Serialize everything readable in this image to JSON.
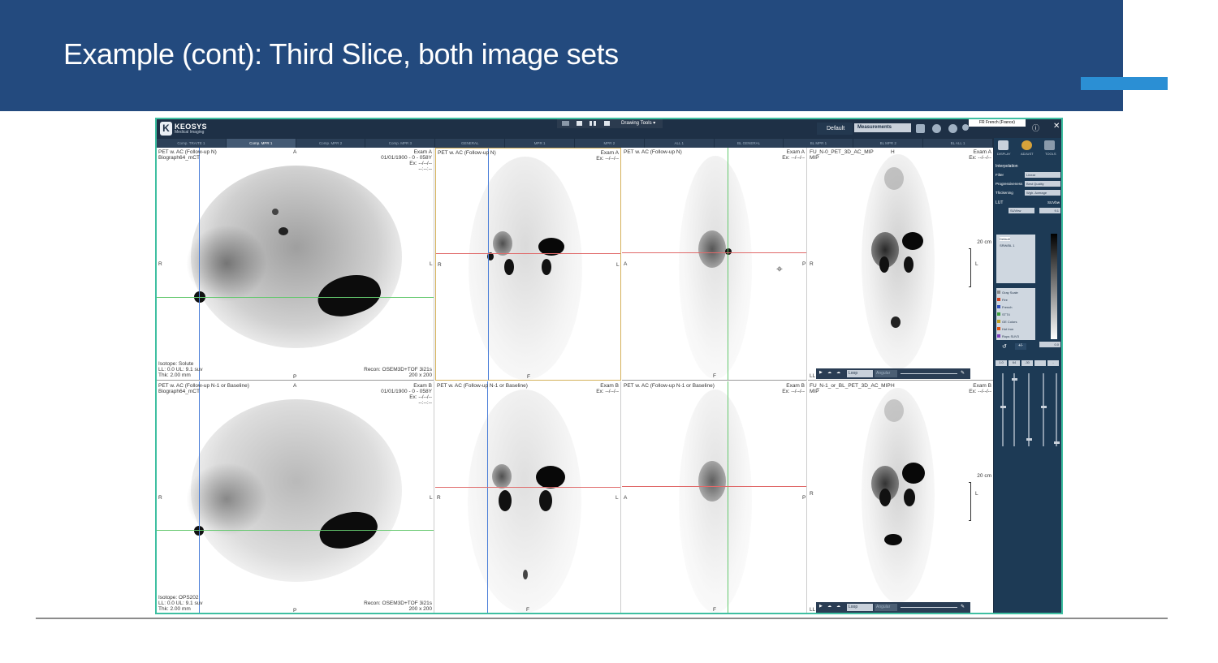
{
  "slide": {
    "title": "Example (cont): Third Slice, both image sets"
  },
  "app": {
    "logo_mark": "K",
    "logo_name": "KEOSYS",
    "logo_sub": "Medical Imaging",
    "drawing_tools": "Drawing Tools ▾",
    "preset": "Default",
    "measurements": "Measurements",
    "locale": "FR French (France)",
    "info_icon": "ⓘ",
    "close_icon": "✕"
  },
  "tabs": [
    "Comp. TRAITE 1",
    "Comp. MPR 1",
    "Comp. MPR 2",
    "Comp. MPR 3",
    "GENERAL",
    "MPR 1",
    "MPR 2",
    "ALL 1",
    "BL GENERAL",
    "BL MPR 1",
    "BL MPR 2",
    "BL ALL 1"
  ],
  "active_tab": 1,
  "top": {
    "axial": {
      "name": "PET w. AC (Follow-up N)",
      "scanner": "Biograph64_mCT",
      "orient_top": "A",
      "exam": "Exam A",
      "date": "01/01/1900 - 0 - 058Y",
      "ex": "Ex: --/--/--",
      "ex2": "--:--:--",
      "left": "R",
      "right": "L",
      "bottom": "P",
      "iso": "Isotope: Solute",
      "ll": "LL: 0.0  UL: 9.1 suv",
      "thk": "Thk: 2.00 mm",
      "recon": "Recon: OSEM3D+TOF 3i21s",
      "matrix": "200 x 200"
    },
    "coronal": {
      "name": "PET w. AC (Follow-up N)",
      "exam": "Exam A",
      "ex": "Ex: --/--/--",
      "left": "R",
      "right": "L",
      "bottom": "F"
    },
    "sagittal": {
      "name": "PET w. AC (Follow-up N)",
      "exam": "Exam A",
      "ex": "Ex: --/--/--",
      "left": "A",
      "right": "P",
      "bottom": "F"
    },
    "mip": {
      "name": "FU_N-0_PET_3D_AC_MIP",
      "sub": "MIP",
      "orient_top": "H",
      "exam": "Exam A",
      "ex": "Ex: --/--/--",
      "left": "R",
      "right": "L",
      "scale": "20 cm",
      "corner": "LL"
    }
  },
  "bottom": {
    "axial": {
      "name": "PET w. AC (Follow-up N-1 or Baseline)",
      "scanner": "Biograph64_mCT",
      "orient_top": "A",
      "exam": "Exam B",
      "date": "01/01/1900 - 0 - 058Y",
      "ex": "Ex: --/--/--",
      "ex2": "--:--:--",
      "left": "R",
      "right": "L",
      "bottom": "P",
      "iso": "Isotope: OPS202",
      "ll": "LL: 0.0  UL: 9.1 suv",
      "thk": "Thk: 2.00 mm",
      "recon": "Recon: OSEM3D+TOF 3i21s",
      "matrix": "200 x 200"
    },
    "coronal": {
      "name": "PET w. AC (Follow-up N-1 or Baseline)",
      "exam": "Exam B",
      "ex": "Ex: --/--/--",
      "left": "R",
      "right": "L",
      "bottom": "F"
    },
    "sagittal": {
      "name": "PET w. AC (Follow-up N-1 or Baseline)",
      "exam": "Exam B",
      "ex": "Ex: --/--/--",
      "left": "A",
      "right": "P",
      "bottom": "F"
    },
    "mip": {
      "name": "FU_N-1_or_BL_PET_3D_AC_MIP",
      "sub": "MIP",
      "orient_top": "H",
      "exam": "Exam B",
      "ex": "Ex: --/--/--",
      "left": "R",
      "right": "L",
      "scale": "20 cm",
      "corner": "LL"
    }
  },
  "player": {
    "loop": "Loop",
    "angular": "Angular"
  },
  "panel": {
    "display": "DISPLAY",
    "adjust": "ADJUST",
    "tools": "TOOLS",
    "interpolation": "Interpolation",
    "filter_label": "Filter",
    "filter_value": "Linear",
    "progressiveness_label": "Progressiveness",
    "progressiveness_value": "Best Quality",
    "thickness_label": "Thickening",
    "thickness_value": "Wgh. Average",
    "lut": "LUT",
    "lut_unit": "SUVbw",
    "lut_select": "SUVbw",
    "lut_max": "9.1",
    "lut_min": "0.0",
    "lut_items": [
      "Default",
      "SRW/BL 1"
    ],
    "color_items": [
      "Gray Scale",
      "Fire",
      "French",
      "STT4",
      "GE Colors",
      "Hot Iron",
      "Rops SUV3"
    ],
    "color_swatches": [
      "#8a8a8a",
      "#d04020",
      "#3050c0",
      "#40a040",
      "#c0a020",
      "#e05010",
      "#8040c0"
    ],
    "adj_values": [
      "1.0",
      "64",
      "-30",
      "",
      "-"
    ]
  },
  "colors": {
    "banner": "#234a7e",
    "accent": "#2b8fd4",
    "frame": "#3fbfa1",
    "crosshair_blue": "#4a7ed8",
    "crosshair_green": "#64c86e",
    "crosshair_red": "#e06a6a",
    "focus": "#d4b15a"
  }
}
